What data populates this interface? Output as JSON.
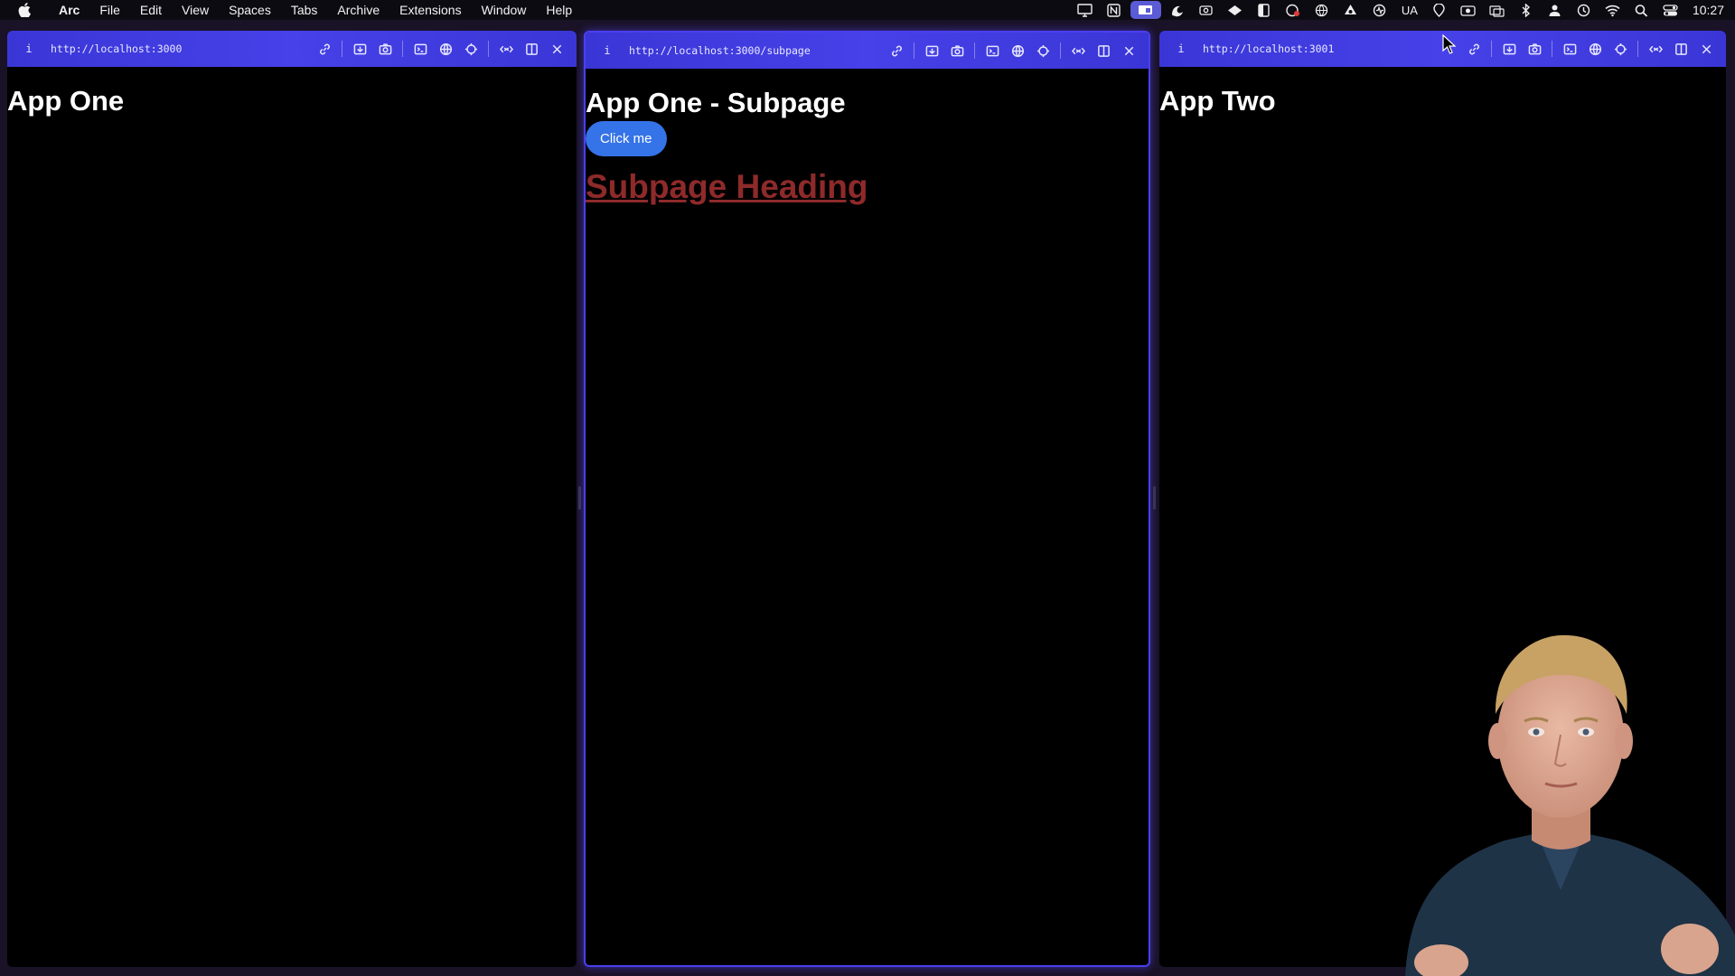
{
  "menubar": {
    "app_name": "Arc",
    "items": [
      "File",
      "Edit",
      "View",
      "Spaces",
      "Tabs",
      "Archive",
      "Extensions",
      "Window",
      "Help"
    ],
    "tray_text": "UA",
    "clock": "10:27",
    "tray_icons": [
      "display-icon",
      "notion-icon",
      "screen-share-icon",
      "arc-icon",
      "camera-icon",
      "vpn-icon",
      "sidebar-icon",
      "recorder-icon",
      "globe-icon",
      "drive-icon",
      "activity-icon",
      "keyboard-lang",
      "location-icon",
      "video-icon",
      "window-icon",
      "bluetooth-icon",
      "user-icon",
      "timemachine-icon",
      "wifi-icon",
      "search-icon",
      "control-center-icon"
    ]
  },
  "panes": [
    {
      "url": "http://localhost:3000",
      "heading": "App One"
    },
    {
      "url": "http://localhost:3000/subpage",
      "heading": "App One - Subpage",
      "button_label": "Click me",
      "subheading": "Subpage Heading"
    },
    {
      "url": "http://localhost:3001",
      "heading": "App Two"
    }
  ],
  "colors": {
    "toolbar": "#4641e8",
    "button": "#3573e8",
    "subheading": "#8e2a2a",
    "focus_border": "#4a3ff0"
  }
}
